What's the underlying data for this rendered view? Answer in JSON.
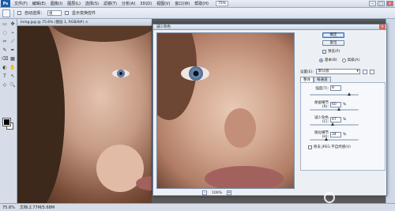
{
  "app": {
    "logo_text": "Ps",
    "zoom_chip": "75%"
  },
  "menu": {
    "items": [
      "文件(F)",
      "编辑(E)",
      "图像(I)",
      "图层(L)",
      "选择(S)",
      "滤镜(T)",
      "分析(A)",
      "3D(D)",
      "视图(V)",
      "窗口(W)",
      "帮助(H)"
    ]
  },
  "window_buttons": {
    "min": "–",
    "max": "□",
    "close": "×"
  },
  "options_bar": {
    "auto_select_label": "自动选择：",
    "auto_select_value": "组",
    "show_transform_label": "显示变换控件"
  },
  "tools": {
    "items": [
      "▭",
      "✥",
      "◌",
      "⌁",
      "✂",
      "⟋",
      "✎",
      "✒",
      "⌫",
      "▦",
      "◐",
      "✋",
      "T",
      "↖",
      "◇",
      "🔍"
    ]
  },
  "document": {
    "tab_title": "lnmg.jpg @ 75.6% (图层 1, RGB/8#) ×"
  },
  "status": {
    "zoom": "75.6%",
    "doc_info": "文档:2.77M/5.68M"
  },
  "dialog": {
    "title": "减少杂色",
    "ok": "确定",
    "reset": "复位",
    "preview_label": "预览(P)",
    "mode_basic": "基本(B)",
    "mode_advanced": "高级(A)",
    "settings_label": "设置(E):",
    "settings_value": "默认值",
    "tab_overall": "整体",
    "tab_per_channel": "每通道",
    "preview_zoom": "100%",
    "zoom_out": "–",
    "zoom_in": "+",
    "params": [
      {
        "label": "强度(T):",
        "value": "8",
        "unit": "",
        "level": 0.8
      },
      {
        "label": "保留细节(R):",
        "value": "60",
        "unit": "%",
        "level": 0.6
      },
      {
        "label": "减少杂色(C):",
        "value": "47",
        "unit": "%",
        "level": 0.47
      },
      {
        "label": "锐化细节(H):",
        "value": "34",
        "unit": "%",
        "level": 0.34
      }
    ],
    "artifact_label": "移去 JPEG 不自然感(V)"
  }
}
